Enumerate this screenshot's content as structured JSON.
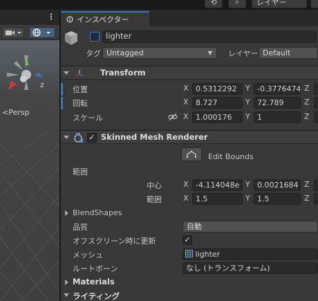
{
  "toolbar": {
    "layer_dropdown": "レイヤー"
  },
  "scene": {
    "persp_label": "<Persp",
    "gizmo_axis_z": "z"
  },
  "inspector": {
    "tab_label": "インスペクター",
    "object_name": "lighter",
    "tag_label": "タグ",
    "tag_value": "Untagged",
    "layer_label": "レイヤー",
    "layer_value": "Default"
  },
  "transform": {
    "title": "Transform",
    "position_label": "位置",
    "rotation_label": "回転",
    "scale_label": "スケール",
    "axis_x": "X",
    "axis_y": "Y",
    "axis_z": "Z",
    "position": {
      "x": "0.5312292",
      "y": "-0.3776474"
    },
    "rotation": {
      "x": "8.727",
      "y": "72.789"
    },
    "scale": {
      "x": "1.000176",
      "y": "1"
    }
  },
  "renderer": {
    "title": "Skinned Mesh Renderer",
    "enabled": true,
    "edit_bounds_label": "Edit Bounds",
    "bounds_label": "範囲",
    "center_label": "中心",
    "extent_label": "範囲",
    "center": {
      "x": "-4.114048e",
      "y": "0.0021684"
    },
    "extent": {
      "x": "1.5",
      "y": "1.5"
    },
    "blendshapes_label": "BlendShapes",
    "quality_label": "品質",
    "quality_value": "自動",
    "offscreen_label": "オフスクリーン時に更新",
    "offscreen_checked": true,
    "mesh_label": "メッシュ",
    "mesh_value": "lighter",
    "root_bone_label": "ルートボーン",
    "root_bone_value": "なし (トランスフォーム)"
  },
  "materials": {
    "title": "Materials"
  },
  "lighting": {
    "title": "ライティング"
  }
}
